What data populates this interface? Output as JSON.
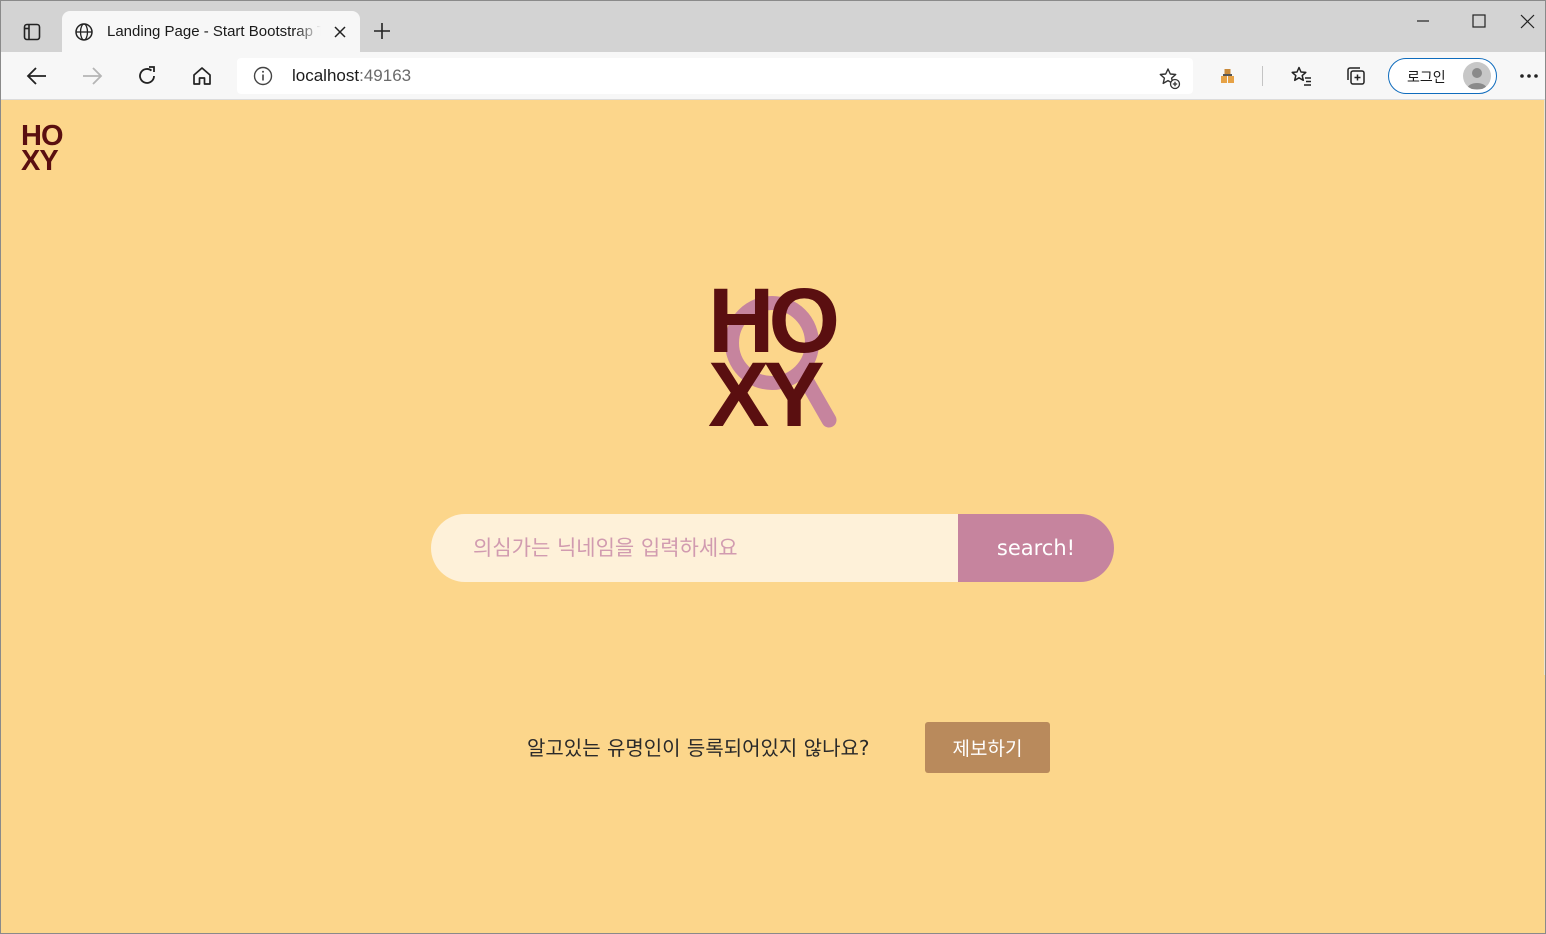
{
  "browser": {
    "tab": {
      "title": "Landing Page - Start Bootstrap Theme"
    },
    "address": {
      "host": "localhost",
      "port": ":49163"
    },
    "profile_label": "로그인"
  },
  "site": {
    "nav_logo": {
      "line1": "HO",
      "line2": "XY"
    },
    "hero_logo": {
      "line1": "HO",
      "line2": "XY"
    },
    "search": {
      "placeholder": "의심가는 닉네임을 입력하세요",
      "button_label": "search!"
    },
    "report": {
      "prompt": "알고있는 유명인이 등록되어있지 않나요?",
      "button_label": "제보하기"
    }
  },
  "colors": {
    "page_background": "#fcd68b",
    "logo_text": "#5a0f10",
    "magnifier": "#c6849e",
    "search_field": "#fef1d9",
    "search_button": "#c6849e",
    "report_button": "#b98a5c"
  },
  "icons": {
    "tab_actions": "tab-actions-icon",
    "favicon": "globe-icon",
    "back": "back-arrow-icon",
    "forward": "forward-arrow-icon",
    "refresh": "refresh-icon",
    "home": "home-icon",
    "favorites": "favorites-icon",
    "collections": "collections-icon",
    "more": "more-icon"
  }
}
